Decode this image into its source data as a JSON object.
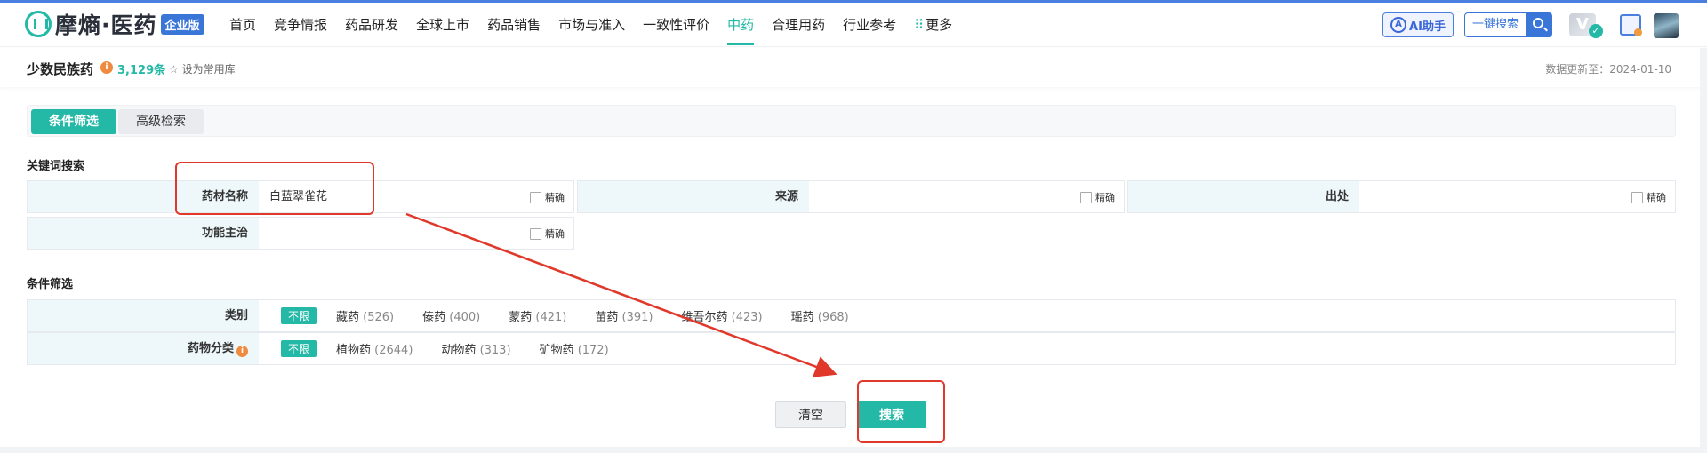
{
  "header": {
    "logo_text": "摩熵·医药",
    "logo_badge": "企业版",
    "nav": [
      "首页",
      "竞争情报",
      "药品研发",
      "全球上市",
      "药品销售",
      "市场与准入",
      "一致性评价",
      "中药",
      "合理用药",
      "行业参考"
    ],
    "nav_active": "中药",
    "nav_more": "更多",
    "ai_button": "AI助手",
    "quick_search": "一键搜索"
  },
  "subheader": {
    "title": "少数民族药",
    "count": "3,129条",
    "favorite": "设为常用库",
    "update_time": "数据更新至：2024-01-10"
  },
  "tabs": {
    "filter": "条件筛选",
    "advanced": "高级检索"
  },
  "keyword_section": {
    "label": "关键词搜索",
    "exact_label": "精确",
    "fields": [
      {
        "label": "药材名称",
        "value": "白蓝翠雀花"
      },
      {
        "label": "来源",
        "value": ""
      },
      {
        "label": "出处",
        "value": ""
      },
      {
        "label": "功能主治",
        "value": ""
      }
    ]
  },
  "condition_section": {
    "label": "条件筛选",
    "any_label": "不限",
    "rows": [
      {
        "label": "类别",
        "options": [
          {
            "name": "藏药",
            "count": "(526)"
          },
          {
            "name": "傣药",
            "count": "(400)"
          },
          {
            "name": "蒙药",
            "count": "(421)"
          },
          {
            "name": "苗药",
            "count": "(391)"
          },
          {
            "name": "维吾尔药",
            "count": "(423)"
          },
          {
            "name": "瑶药",
            "count": "(968)"
          }
        ]
      },
      {
        "label": "药物分类",
        "options": [
          {
            "name": "植物药",
            "count": "(2644)"
          },
          {
            "name": "动物药",
            "count": "(313)"
          },
          {
            "name": "矿物药",
            "count": "(172)"
          }
        ]
      }
    ]
  },
  "buttons": {
    "clear": "清空",
    "search": "搜索"
  },
  "colors": {
    "primary": "#24b8a6",
    "brand_blue": "#3a75d8",
    "annotation": "#e0392b"
  }
}
